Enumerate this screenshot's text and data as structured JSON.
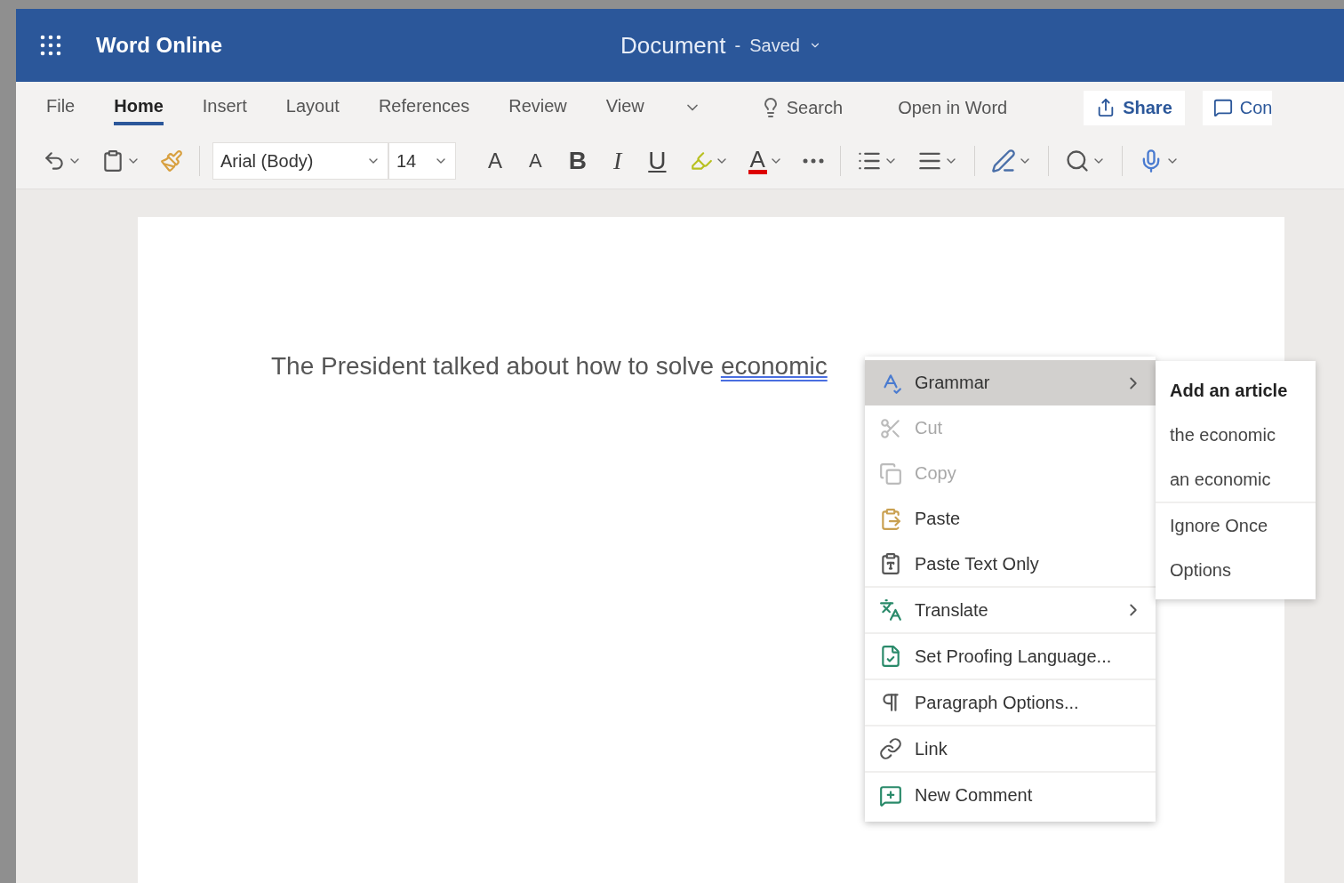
{
  "header": {
    "app_name": "Word Online",
    "document_title": "Document",
    "separator": "-",
    "save_status": "Saved"
  },
  "tabs": [
    {
      "label": "File",
      "selected": false
    },
    {
      "label": "Home",
      "selected": true
    },
    {
      "label": "Insert",
      "selected": false
    },
    {
      "label": "Layout",
      "selected": false
    },
    {
      "label": "References",
      "selected": false
    },
    {
      "label": "Review",
      "selected": false
    },
    {
      "label": "View",
      "selected": false
    }
  ],
  "tab_bar_actions": {
    "search": "Search",
    "open_in_word": "Open in Word",
    "share": "Share",
    "comments": "Con"
  },
  "toolbar": {
    "font_name": "Arial (Body)",
    "font_size": "14",
    "grow_font": "A",
    "shrink_font": "A",
    "bold": "B",
    "italic": "I",
    "underline": "U",
    "font_color": "A"
  },
  "document": {
    "text": "The President talked about how to solve",
    "flagged_word": "economic"
  },
  "context_menu": {
    "items": [
      {
        "label": "Grammar",
        "selected": true,
        "disabled": false,
        "submenu": true,
        "divider_after": false
      },
      {
        "label": "Cut",
        "selected": false,
        "disabled": true,
        "submenu": false,
        "divider_after": false
      },
      {
        "label": "Copy",
        "selected": false,
        "disabled": true,
        "submenu": false,
        "divider_after": false
      },
      {
        "label": "Paste",
        "selected": false,
        "disabled": false,
        "submenu": false,
        "divider_after": false
      },
      {
        "label": "Paste Text Only",
        "selected": false,
        "disabled": false,
        "submenu": false,
        "divider_after": true
      },
      {
        "label": "Translate",
        "selected": false,
        "disabled": false,
        "submenu": true,
        "divider_after": true
      },
      {
        "label": "Set Proofing Language...",
        "selected": false,
        "disabled": false,
        "submenu": false,
        "divider_after": true
      },
      {
        "label": "Paragraph Options...",
        "selected": false,
        "disabled": false,
        "submenu": false,
        "divider_after": true
      },
      {
        "label": "Link",
        "selected": false,
        "disabled": false,
        "submenu": false,
        "divider_after": true
      },
      {
        "label": "New Comment",
        "selected": false,
        "disabled": false,
        "submenu": false,
        "divider_after": false
      }
    ]
  },
  "grammar_submenu": {
    "items": [
      {
        "kind": "heading",
        "label": "Add an article",
        "divider_after": false
      },
      {
        "kind": "option",
        "label": "the economic",
        "divider_after": false
      },
      {
        "kind": "option",
        "label": "an economic",
        "divider_after": true
      },
      {
        "kind": "option",
        "label": "Ignore Once",
        "divider_after": false
      },
      {
        "kind": "option",
        "label": "Options",
        "divider_after": false
      }
    ]
  }
}
